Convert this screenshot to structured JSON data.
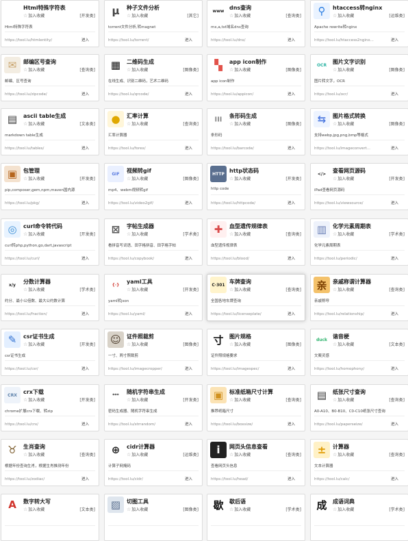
{
  "fav_label": "加入收藏",
  "enter_label": "进入",
  "cards": [
    {
      "title": "Html特殊字符表",
      "category": "[开发类]",
      "desc": "Html特殊字符表",
      "url": "https://tool.lu/htmlentity/",
      "icon": "code-icon",
      "glyph": "</>",
      "bg": "#ffffff",
      "fg": "#222222"
    },
    {
      "title": "种子文件分析",
      "category": "[其它]",
      "desc": "torrent文件分析,转magnet",
      "url": "https://tool.lu/torrent/",
      "icon": "torrent-icon",
      "glyph": "μ",
      "bg": "#ffffff",
      "fg": "#444444"
    },
    {
      "title": "dns查询",
      "category": "[查询类]",
      "desc": "mx,a,txt域名dns查询",
      "url": "https://tool.lu/dns/",
      "icon": "www-icon",
      "glyph": "www",
      "bg": "#ffffff",
      "fg": "#222222"
    },
    {
      "title": "htaccess转nginx",
      "category": "[运维类]",
      "desc": "Apache rewrite转nginx",
      "url": "https://tool.lu/htaccess2nginx...",
      "icon": "map-pin-icon",
      "glyph": "⚲",
      "bg": "#eaf3ff",
      "fg": "#2a7de1"
    },
    {
      "title": "邮编区号查询",
      "category": "[查询类]",
      "desc": "邮编、区号查询",
      "url": "https://tool.lu/zipcode/",
      "icon": "envelope-icon",
      "glyph": "✉",
      "bg": "#f3ede2",
      "fg": "#c9a36b"
    },
    {
      "title": "二维码生成",
      "category": "[图像类]",
      "desc": "在线生成、识别二维码，艺术二维码",
      "url": "https://tool.lu/qrcode/",
      "icon": "qrcode-icon",
      "glyph": "▦",
      "bg": "#ffffff",
      "fg": "#111111"
    },
    {
      "title": "app icon制作",
      "category": "[图像类]",
      "desc": "app icon制作",
      "url": "https://tool.lu/appicon/",
      "icon": "app-grid-icon",
      "glyph": "▚",
      "bg": "#ffffff",
      "fg": "#e2524a"
    },
    {
      "title": "图片文字识别",
      "category": "[图像类]",
      "desc": "图片转文字，OCR",
      "url": "https://tool.lu/ocr/",
      "icon": "ocr-icon",
      "glyph": "OCR",
      "bg": "#ffffff",
      "fg": "#2bb3a3"
    },
    {
      "title": "ascii table生成",
      "category": "[文本类]",
      "desc": "markdown table生成",
      "url": "https://tool.lu/tables/",
      "icon": "table-icon",
      "glyph": "▤",
      "bg": "#ffffff",
      "fg": "#333333"
    },
    {
      "title": "汇率计算",
      "category": "[查询类]",
      "desc": "汇率计算器",
      "url": "https://tool.lu/forex/",
      "icon": "coins-icon",
      "glyph": "●",
      "bg": "#fff6d9",
      "fg": "#e0a800"
    },
    {
      "title": "条形码生成",
      "category": "[图像类]",
      "desc": "条形码",
      "url": "https://tool.lu/barcode/",
      "icon": "barcode-icon",
      "glyph": "║║║",
      "bg": "#ffffff",
      "fg": "#111111"
    },
    {
      "title": "图片格式转换",
      "category": "[图像类]",
      "desc": "支持webp,jpg,png,bmp等格式",
      "url": "https://tool.lu/imageconvert...",
      "icon": "image-convert-icon",
      "glyph": "⇆",
      "bg": "#eef4ff",
      "fg": "#4f7ae0"
    },
    {
      "title": "包管理",
      "category": "[开发类]",
      "desc": "pip,composer,gem,npm,maven国内源",
      "url": "https://tool.lu/pkg/",
      "icon": "package-icon",
      "glyph": "▣",
      "bg": "#f4e2cf",
      "fg": "#b5651d"
    },
    {
      "title": "视频转gif",
      "category": "[图像类]",
      "desc": "mp4、webm视频转gif",
      "url": "https://tool.lu/video2gif/",
      "icon": "gif-file-icon",
      "glyph": "GIF",
      "bg": "#eaf0ff",
      "fg": "#5a7be0"
    },
    {
      "title": "http状态码",
      "category": "[开发类]",
      "desc": "http code",
      "url": "https://tool.lu/httpcode/",
      "icon": "http-icon",
      "glyph": "HTTP",
      "bg": "#5a6f8f",
      "fg": "#ffffff"
    },
    {
      "title": "查看网页源码",
      "category": "[开发类]",
      "desc": "iPad查看网页源码",
      "url": "https://tool.lu/viewsource/",
      "icon": "source-code-icon",
      "glyph": "&lt;/&gt;",
      "bg": "#ffffff",
      "fg": "#222222"
    },
    {
      "title": "curl命令转代码",
      "category": "[开发类]",
      "desc": "curl转php,python,go,dart,javascript",
      "url": "https://tool.lu/curl/",
      "icon": "curl-icon",
      "glyph": "◎",
      "bg": "#e8f3ff",
      "fg": "#3b8fd6"
    },
    {
      "title": "字帖生成器",
      "category": "[学术类]",
      "desc": "看拼音写词语、田字格拼音、田字格字帖",
      "url": "https://tool.lu/copybook/",
      "icon": "copybook-icon",
      "glyph": "⊠",
      "bg": "#ffffff",
      "fg": "#555555"
    },
    {
      "title": "血型遗传规律表",
      "category": "[查询类]",
      "desc": "血型遗传规律表",
      "url": "https://tool.lu/blood/",
      "icon": "syringe-icon",
      "glyph": "✚",
      "bg": "#fff0f0",
      "fg": "#d94a4a"
    },
    {
      "title": "化学元素周期表",
      "category": "[学术类]",
      "desc": "化学元素周期表",
      "url": "https://tool.lu/periodic/",
      "icon": "periodic-table-icon",
      "glyph": "▥",
      "bg": "#eef2fb",
      "fg": "#6a7fb5"
    },
    {
      "title": "分数计算器",
      "category": "[学术类]",
      "desc": "约分、最小公倍数、最大公约数计算",
      "url": "https://tool.lu/fraction/",
      "icon": "fraction-icon",
      "glyph": "x/y",
      "bg": "#ffffff",
      "fg": "#222222"
    },
    {
      "title": "yaml工具",
      "category": "[开发类]",
      "desc": "yaml转json",
      "url": "https://tool.lu/yaml/",
      "icon": "braces-icon",
      "glyph": "{·}",
      "bg": "#ffffff",
      "fg": "#d0342c"
    },
    {
      "title": "车牌查询",
      "category": "[查询类]",
      "desc": "全国各地车牌查询",
      "url": "https://tool.lu/licenseplate/",
      "icon": "license-plate-icon",
      "glyph": "C·301",
      "bg": "#fff4cc",
      "fg": "#222222",
      "highlight": true
    },
    {
      "title": "亲戚称谓计算器",
      "category": "[查询类]",
      "desc": "亲戚称呼",
      "url": "https://tool.lu/relationship/",
      "icon": "relationship-icon",
      "glyph": "亲",
      "bg": "#f4c26b",
      "fg": "#7a3e00"
    },
    {
      "title": "csr证书生成",
      "category": "[开发类]",
      "desc": "csr证书生成",
      "url": "https://tool.lu/csr/",
      "icon": "certificate-icon",
      "glyph": "✎",
      "bg": "#e3efff",
      "fg": "#2e6fd1"
    },
    {
      "title": "证件照裁剪",
      "category": "[图像类]",
      "desc": "一寸、两寸照裁剪",
      "url": "https://tool.lu/imagecropper/",
      "icon": "portrait-icon",
      "glyph": "☺",
      "bg": "#d8d2c8",
      "fg": "#4a3a2a"
    },
    {
      "title": "图片规格",
      "category": "[图像类]",
      "desc": "证件照规格要求",
      "url": "https://tool.lu/imagespec/",
      "icon": "cun-icon",
      "glyph": "寸",
      "bg": "#ffffff",
      "fg": "#111111"
    },
    {
      "title": "谐音梗",
      "category": "[文本类]",
      "desc": "文案灵感",
      "url": "https://tool.lu/homophony/",
      "icon": "duck-icon",
      "glyph": "duck",
      "bg": "#ffffff",
      "fg": "#2bb36b"
    },
    {
      "title": "crx下载",
      "category": "[开发类]",
      "desc": "chrome扩展crx下载、转zip",
      "url": "https://tool.lu/crx/",
      "icon": "crx-file-icon",
      "glyph": "CRX",
      "bg": "#eef3fa",
      "fg": "#5a7fa8"
    },
    {
      "title": "随机字符串生成",
      "category": "[开发类]",
      "desc": "密码生成器、随机字符串生成",
      "url": "https://tool.lu/strrandom/",
      "icon": "password-icon",
      "glyph": "***",
      "bg": "#ffffff",
      "fg": "#222222"
    },
    {
      "title": "标准纸箱尺寸计算",
      "category": "[查询类]",
      "desc": "推荐纸箱尺寸",
      "url": "https://tool.lu/boxsize/",
      "icon": "box-icon",
      "glyph": "▣",
      "bg": "#fbe3b5",
      "fg": "#d1911f"
    },
    {
      "title": "纸张尺寸查询",
      "category": "[查询类]",
      "desc": "A0-A10、B0-B10、C0-C10纸张尺寸查询",
      "url": "https://tool.lu/paperseize/",
      "icon": "paper-icon",
      "glyph": "▤",
      "bg": "#ffffff",
      "fg": "#333333"
    },
    {
      "title": "生肖查询",
      "category": "[查询类]",
      "desc": "根据年份查询生肖，根据生肖推测年份",
      "url": "https://tool.lu/zodiac/",
      "icon": "ox-icon",
      "glyph": "♉",
      "bg": "#ffffff",
      "fg": "#7a5a2a"
    },
    {
      "title": "cidr计算器",
      "category": "[运维类]",
      "desc": "计算子网掩码",
      "url": "https://tool.lu/cidr/",
      "icon": "globe-icon",
      "glyph": "⊕",
      "bg": "#ffffff",
      "fg": "#222222"
    },
    {
      "title": "网页头信息查看",
      "category": "[查询类]",
      "desc": "查看网页头信息",
      "url": "https://tool.lu/head/",
      "icon": "info-icon",
      "glyph": "i",
      "bg": "#222222",
      "fg": "#ffffff"
    },
    {
      "title": "计算器",
      "category": "[查询类]",
      "desc": "文本计算器",
      "url": "https://tool.lu/calc/",
      "icon": "calculator-icon",
      "glyph": "±",
      "bg": "#fff1c6",
      "fg": "#e09a00"
    },
    {
      "title": "数字转大写",
      "category": "[文本类]",
      "desc": "",
      "url": "",
      "icon": "font-size-icon",
      "glyph": "A",
      "bg": "#ffffff",
      "fg": "#d0342c"
    },
    {
      "title": "切图工具",
      "category": "[图像类]",
      "desc": "",
      "url": "",
      "icon": "slice-image-icon",
      "glyph": "▨",
      "bg": "#dfe6ee",
      "fg": "#5a6f8f"
    },
    {
      "title": "歇后语",
      "category": "[学术类]",
      "desc": "",
      "url": "",
      "icon": "xie-char-icon",
      "glyph": "歇",
      "bg": "#ffffff",
      "fg": "#111111"
    },
    {
      "title": "成语词典",
      "category": "[学术类]",
      "desc": "",
      "url": "",
      "icon": "cheng-char-icon",
      "glyph": "成",
      "bg": "#ffffff",
      "fg": "#111111"
    }
  ]
}
